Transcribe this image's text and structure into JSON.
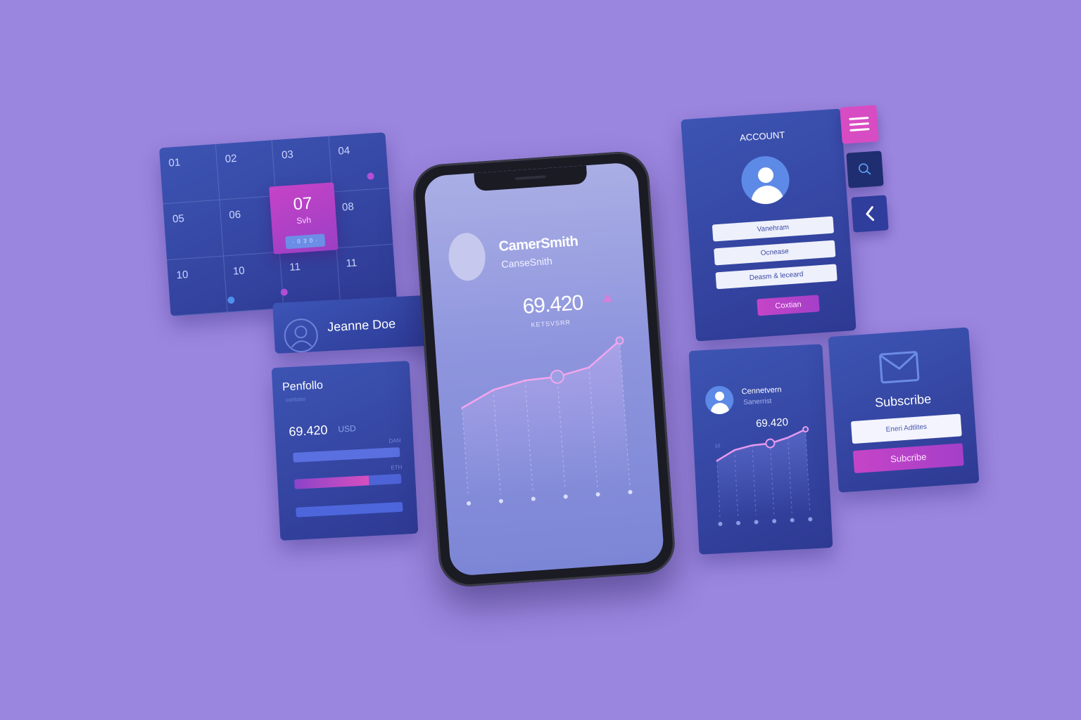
{
  "calendar": {
    "days": [
      "01",
      "02",
      "03",
      "04",
      "05",
      "06",
      "07",
      "08",
      "10",
      "10",
      "11",
      "11"
    ],
    "selected": {
      "day": "07",
      "label": "Svh",
      "pill": "· 0 3 0 ·"
    }
  },
  "profile_chip": {
    "name": "Jeanne Doe"
  },
  "portfolio": {
    "title": "Penfollo",
    "subtitle": "contoso",
    "value": "69.420",
    "currency": "USD",
    "bars": [
      {
        "label": "DAN",
        "fill": 1.0
      },
      {
        "label": "ETH",
        "fill": 0.7
      },
      {
        "label": "",
        "fill": 1.0
      }
    ]
  },
  "phone": {
    "name": "CamerSmith",
    "handle": "CanseSnith",
    "value": "69.420",
    "caption": "KETSVSRR",
    "chart": {
      "type": "line",
      "values": [
        0,
        22,
        32,
        34,
        44,
        78
      ]
    }
  },
  "account": {
    "title": "ACCOUNT",
    "fields": [
      "Vanehram",
      "Ocnease",
      "Deasm & leceard"
    ],
    "button": "Coxtian"
  },
  "icons": {
    "menu": "menu-icon",
    "search": "search-icon",
    "back": "chevron-left-icon"
  },
  "connections": {
    "name": "Cennetvern",
    "sub": "Sanerrist",
    "value": "69.420",
    "axis": "10",
    "chart": {
      "type": "line",
      "values": [
        0,
        20,
        28,
        30,
        40,
        55
      ]
    }
  },
  "subscribe": {
    "title": "Subscribe",
    "placeholder": "Eneri Adtlites",
    "button": "Subcribe"
  },
  "colors": {
    "background": "#9b86df",
    "card": "#2e3a94",
    "accent": "#c544c7",
    "line": "#f0a0f0"
  }
}
